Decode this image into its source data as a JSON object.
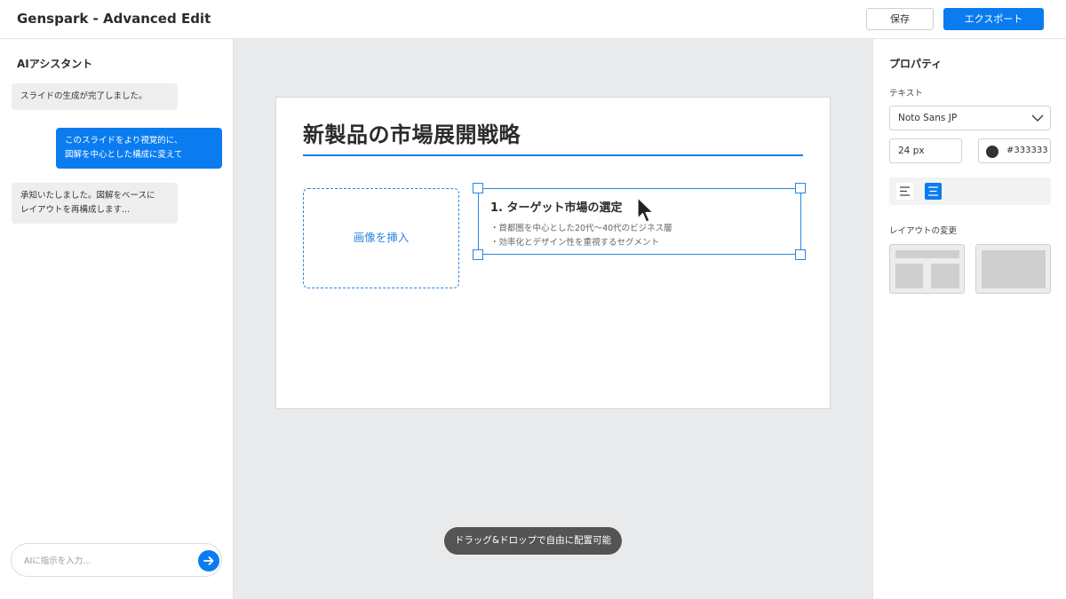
{
  "app": {
    "title": "Genspark - Advanced Edit",
    "save_label": "保存",
    "export_label": "エクスポート",
    "accent_color": "#0a7cf0"
  },
  "assistant": {
    "title": "AIアシスタント",
    "messages": [
      {
        "role": "ai",
        "line1": "スライドの生成が完了しました。",
        "line2": ""
      },
      {
        "role": "user",
        "line1": "このスライドをより視覚的に、",
        "line2": "図解を中心とした構成に変えて"
      },
      {
        "role": "ai",
        "line1": "承知いたしました。図解をベースに",
        "line2": "レイアウトを再構成します..."
      }
    ],
    "input_placeholder": "AIに指示を入力...",
    "send_icon": "arrow-right-icon"
  },
  "slide": {
    "title": "新製品の市場展開戦略",
    "image_placeholder": "画像を挿入",
    "text_box": {
      "heading": "1. ターゲット市場の選定",
      "bullets": [
        "・首都圏を中心とした20代〜40代のビジネス層",
        "・効率化とデザイン性を重視するセグメント"
      ]
    },
    "toast": "ドラッグ&ドロップで自由に配置可能"
  },
  "properties": {
    "title": "プロパティ",
    "text_section": "テキスト",
    "font": "Noto Sans JP",
    "size": "24 px",
    "color": "#333333",
    "align_options": [
      "align-left-icon",
      "align-center-icon"
    ],
    "selected_align": "align-center-icon",
    "layout_section": "レイアウトの変更"
  }
}
